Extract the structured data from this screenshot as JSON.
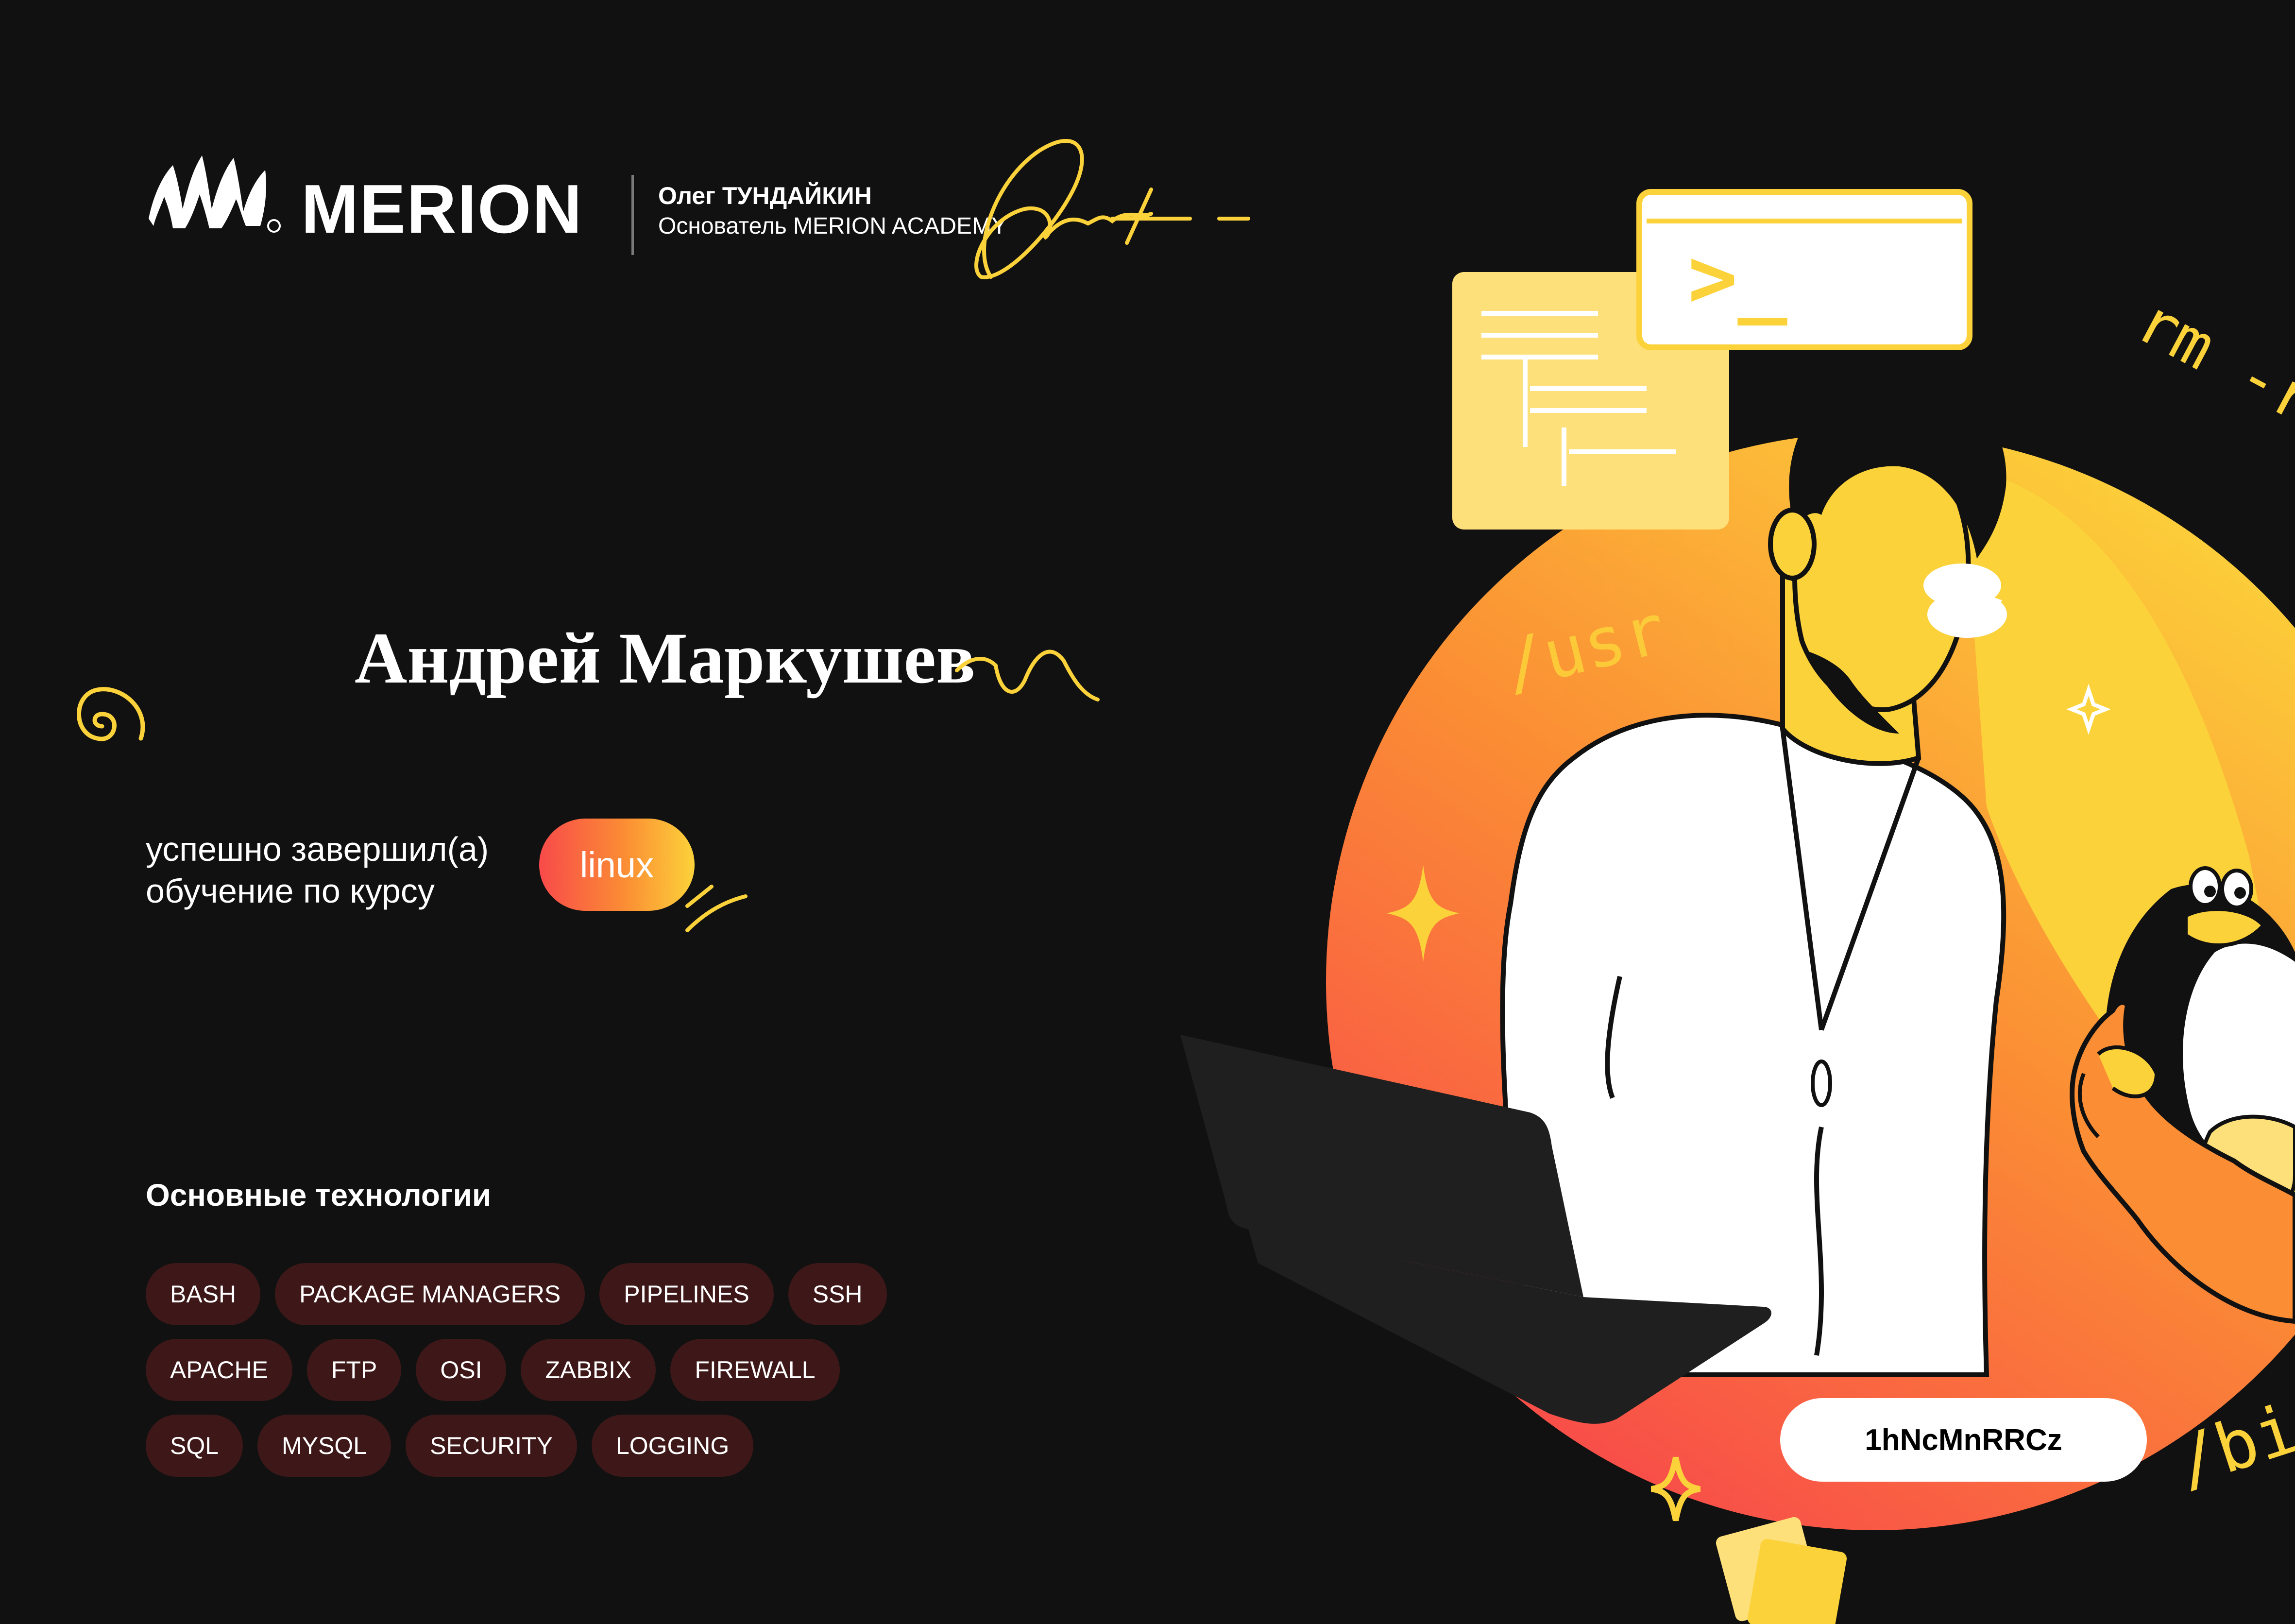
{
  "brand": {
    "name": "MERION",
    "founder_name": "Олег ТУНДАЙКИН",
    "founder_role": "Основатель MERION ACADEMY"
  },
  "student": {
    "name": "Андрей Маркушев"
  },
  "course": {
    "line1": "успешно завершил(а)",
    "line2": "обучение по курсу",
    "name": "linux"
  },
  "technologies": {
    "heading": "Основные технологии",
    "rows": [
      [
        "BASH",
        "PACKAGE MANAGERS",
        "PIPELINES",
        "SSH"
      ],
      [
        "APACHE",
        "FTP",
        "OSI",
        "ZABBIX",
        "FIREWALL"
      ],
      [
        "SQL",
        "MYSQL",
        "SECURITY",
        "LOGGING"
      ]
    ]
  },
  "illustration": {
    "tag_usr": "/usr",
    "tag_rm": "rm -rf",
    "tag_bin": "/bin",
    "prompt": ">_"
  },
  "certificate_id": "1hNcMnRRCz",
  "colors": {
    "background": "#111111",
    "accent_yellow": "#fcd23a",
    "accent_orange": "#fb8d34",
    "accent_red": "#f84a4a",
    "chip": "#3e1818"
  }
}
